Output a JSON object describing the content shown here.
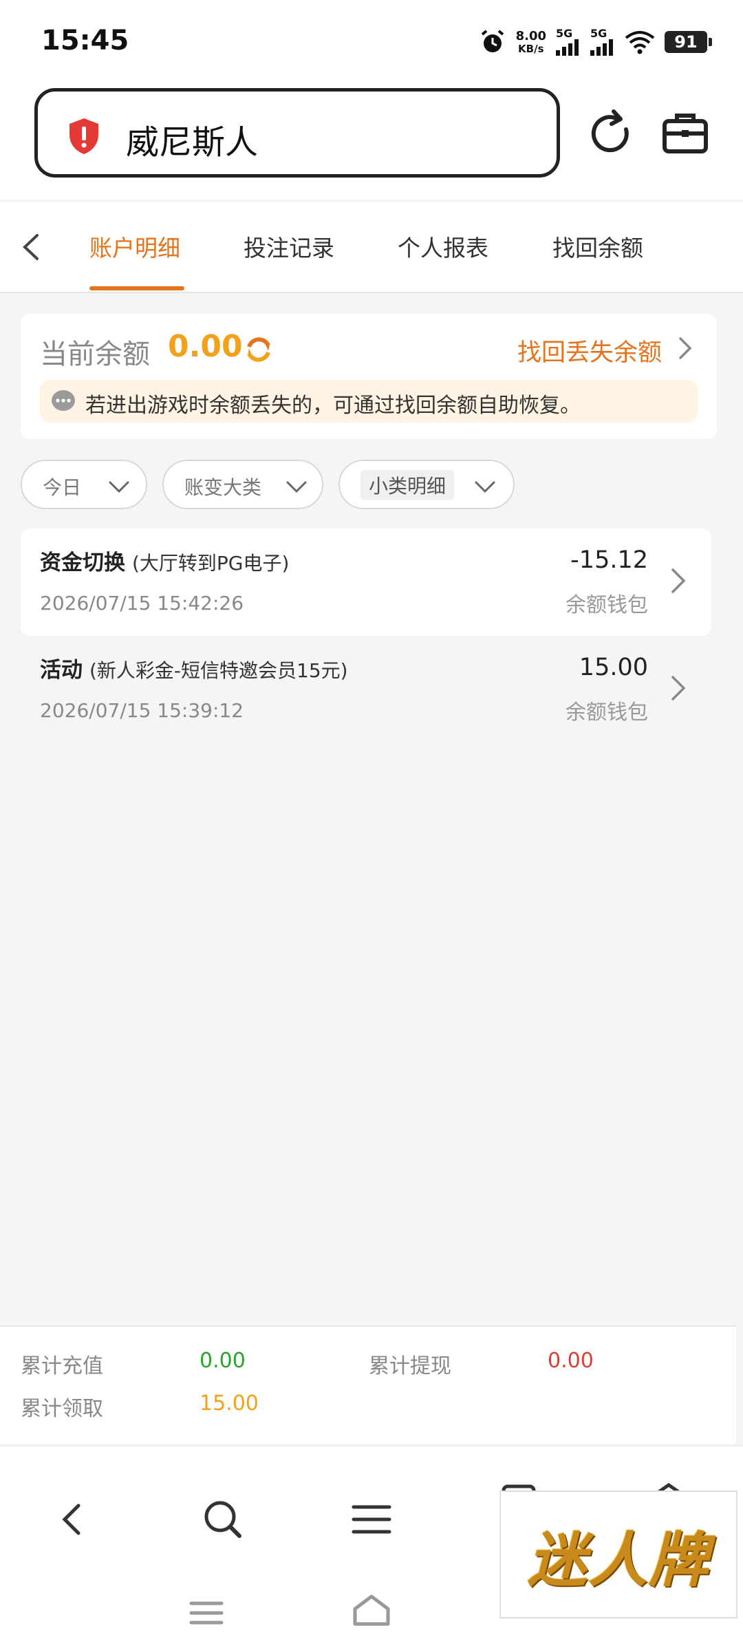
{
  "status_bar": {
    "time": "15:45",
    "net_speed_value": "8.00",
    "net_speed_unit": "KB/s",
    "sim1": "5G",
    "sim2": "5G",
    "battery": "91"
  },
  "address_bar": {
    "title": "威尼斯人",
    "security_icon": "shield-alert-icon",
    "refresh_icon": "refresh-icon",
    "tools_icon": "briefcase-icon"
  },
  "tabs": [
    {
      "label": "账户明细",
      "active": true
    },
    {
      "label": "投注记录",
      "active": false
    },
    {
      "label": "个人报表",
      "active": false
    },
    {
      "label": "找回余额",
      "active": false
    }
  ],
  "balance": {
    "label": "当前余额",
    "value": "0.00",
    "recover_link": "找回丢失余额",
    "notice": "若进出游戏时余额丢失的，可通过找回余额自助恢复。"
  },
  "filters": [
    {
      "label": "今日"
    },
    {
      "label": "账变大类"
    },
    {
      "label": "小类明细"
    }
  ],
  "transactions": [
    {
      "title": "资金切换",
      "subtitle": "(大厅转到PG电子)",
      "time": "2026/07/15 15:42:26",
      "amount": "-15.12",
      "wallet": "余额钱包"
    },
    {
      "title": "活动",
      "subtitle": "(新人彩金-短信特邀会员15元)",
      "time": "2026/07/15 15:39:12",
      "amount": "15.00",
      "wallet": "余额钱包"
    }
  ],
  "summary": {
    "recharge_label": "累计充值",
    "recharge_value": "0.00",
    "withdraw_label": "累计提现",
    "withdraw_value": "0.00",
    "claim_label": "累计领取",
    "claim_value": "15.00",
    "colors": {
      "recharge": "#2aa52a",
      "withdraw": "#d9403a",
      "claim": "#f3a01a"
    }
  },
  "watermark": "迷人牌",
  "colors": {
    "accent": "#e6741d",
    "balance": "#f3a01a"
  }
}
